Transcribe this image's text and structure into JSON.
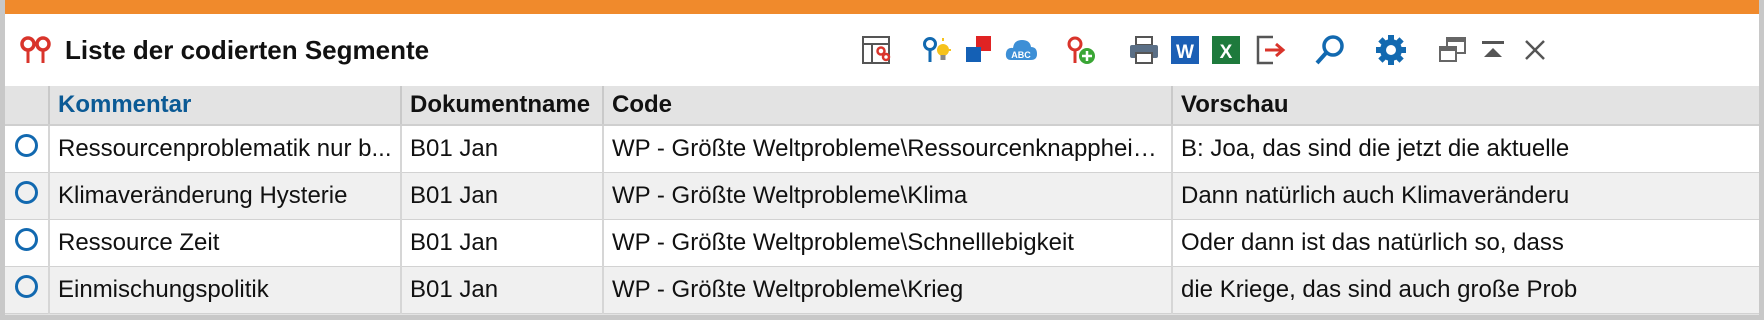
{
  "window": {
    "title": "Liste der codierten Segmente",
    "accent_color": "#f08a2c",
    "title_icon": "coded-segments-icon"
  },
  "toolbar": {
    "icons": [
      "column-settings-icon",
      "code-idea-icon",
      "color-squares-icon",
      "abc-cloud-icon",
      "add-code-icon",
      "print-icon",
      "word-export-icon",
      "excel-export-icon",
      "export-icon",
      "search-icon",
      "gear-icon",
      "undock-icon",
      "collapse-icon",
      "close-icon"
    ],
    "word_label": "W",
    "excel_label": "X",
    "abc_label": "ABC"
  },
  "table": {
    "columns": [
      "",
      "Kommentar",
      "Dokumentname",
      "Code",
      "Vorschau"
    ],
    "sorted_column": "Kommentar",
    "rows": [
      {
        "kommentar": "Ressourcenproblematik nur b...",
        "dokument": "B01 Jan",
        "code": "WP - Größte Weltprobleme\\Ressourcenknappheit,...",
        "vorschau": "B: Joa, das sind die jetzt die aktuelle"
      },
      {
        "kommentar": "Klimaveränderung Hysterie",
        "dokument": "B01 Jan",
        "code": "WP - Größte Weltprobleme\\Klima",
        "vorschau": "Dann natürlich auch Klimaveränderu"
      },
      {
        "kommentar": "Ressource Zeit",
        "dokument": "B01 Jan",
        "code": "WP - Größte Weltprobleme\\Schnelllebigkeit",
        "vorschau": "Oder dann ist das natürlich so, dass"
      },
      {
        "kommentar": "Einmischungspolitik",
        "dokument": "B01 Jan",
        "code": "WP - Größte Weltprobleme\\Krieg",
        "vorschau": "die Kriege, das sind auch große Prob"
      }
    ]
  }
}
